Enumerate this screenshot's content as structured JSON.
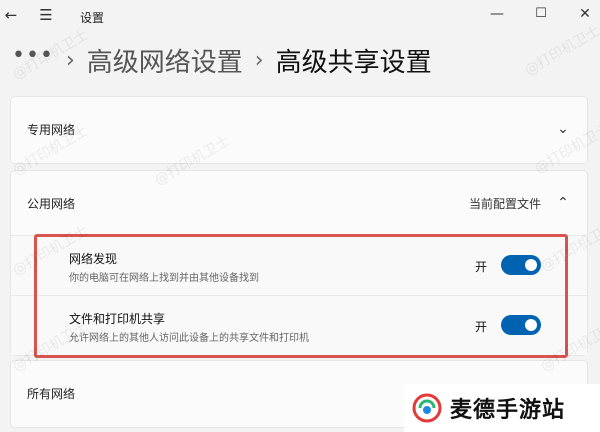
{
  "window": {
    "title": "设置",
    "back_icon": "←",
    "menu_icon": "☰",
    "minimize_icon": "—",
    "maximize_icon": "☐",
    "close_icon": "✕"
  },
  "breadcrumb": {
    "more": "•••",
    "separator": "›",
    "parent": "高级网络设置",
    "current": "高级共享设置"
  },
  "private_network": {
    "title": "专用网络",
    "chevron": "⌄"
  },
  "public_network": {
    "title": "公用网络",
    "aux": "当前配置文件",
    "chevron": "⌃",
    "settings": [
      {
        "label": "网络发现",
        "description": "你的电脑可在网络上找到并由其他设备找到",
        "state_text": "开",
        "on": true
      },
      {
        "label": "文件和打印机共享",
        "description": "允许网络上的其他人访问此设备上的共享文件和打印机",
        "state_text": "开",
        "on": true
      }
    ]
  },
  "all_networks": {
    "title": "所有网络"
  },
  "watermark": "@打印机卫士",
  "brand": {
    "name": "麦德手游站"
  },
  "colors": {
    "accent": "#0063b1",
    "highlight": "#d9534f"
  }
}
